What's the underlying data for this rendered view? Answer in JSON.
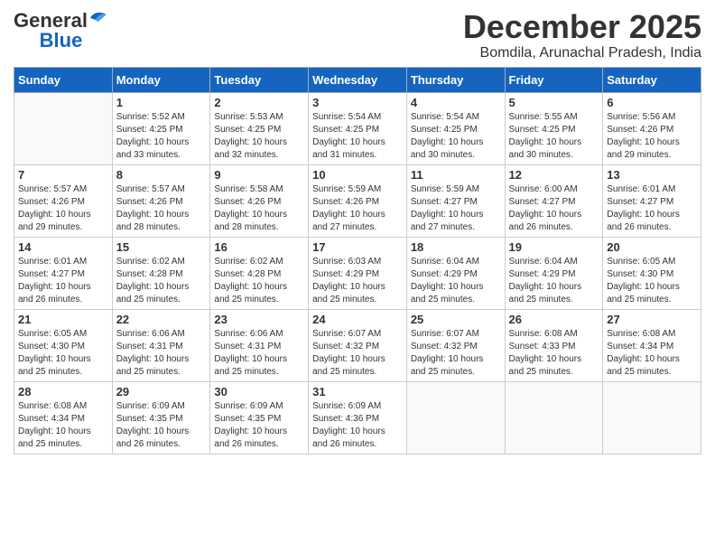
{
  "header": {
    "logo_general": "General",
    "logo_blue": "Blue",
    "month_title": "December 2025",
    "subtitle": "Bomdila, Arunachal Pradesh, India"
  },
  "days_of_week": [
    "Sunday",
    "Monday",
    "Tuesday",
    "Wednesday",
    "Thursday",
    "Friday",
    "Saturday"
  ],
  "weeks": [
    [
      {
        "day": "",
        "info": ""
      },
      {
        "day": "1",
        "info": "Sunrise: 5:52 AM\nSunset: 4:25 PM\nDaylight: 10 hours\nand 33 minutes."
      },
      {
        "day": "2",
        "info": "Sunrise: 5:53 AM\nSunset: 4:25 PM\nDaylight: 10 hours\nand 32 minutes."
      },
      {
        "day": "3",
        "info": "Sunrise: 5:54 AM\nSunset: 4:25 PM\nDaylight: 10 hours\nand 31 minutes."
      },
      {
        "day": "4",
        "info": "Sunrise: 5:54 AM\nSunset: 4:25 PM\nDaylight: 10 hours\nand 30 minutes."
      },
      {
        "day": "5",
        "info": "Sunrise: 5:55 AM\nSunset: 4:25 PM\nDaylight: 10 hours\nand 30 minutes."
      },
      {
        "day": "6",
        "info": "Sunrise: 5:56 AM\nSunset: 4:26 PM\nDaylight: 10 hours\nand 29 minutes."
      }
    ],
    [
      {
        "day": "7",
        "info": "Sunrise: 5:57 AM\nSunset: 4:26 PM\nDaylight: 10 hours\nand 29 minutes."
      },
      {
        "day": "8",
        "info": "Sunrise: 5:57 AM\nSunset: 4:26 PM\nDaylight: 10 hours\nand 28 minutes."
      },
      {
        "day": "9",
        "info": "Sunrise: 5:58 AM\nSunset: 4:26 PM\nDaylight: 10 hours\nand 28 minutes."
      },
      {
        "day": "10",
        "info": "Sunrise: 5:59 AM\nSunset: 4:26 PM\nDaylight: 10 hours\nand 27 minutes."
      },
      {
        "day": "11",
        "info": "Sunrise: 5:59 AM\nSunset: 4:27 PM\nDaylight: 10 hours\nand 27 minutes."
      },
      {
        "day": "12",
        "info": "Sunrise: 6:00 AM\nSunset: 4:27 PM\nDaylight: 10 hours\nand 26 minutes."
      },
      {
        "day": "13",
        "info": "Sunrise: 6:01 AM\nSunset: 4:27 PM\nDaylight: 10 hours\nand 26 minutes."
      }
    ],
    [
      {
        "day": "14",
        "info": "Sunrise: 6:01 AM\nSunset: 4:27 PM\nDaylight: 10 hours\nand 26 minutes."
      },
      {
        "day": "15",
        "info": "Sunrise: 6:02 AM\nSunset: 4:28 PM\nDaylight: 10 hours\nand 25 minutes."
      },
      {
        "day": "16",
        "info": "Sunrise: 6:02 AM\nSunset: 4:28 PM\nDaylight: 10 hours\nand 25 minutes."
      },
      {
        "day": "17",
        "info": "Sunrise: 6:03 AM\nSunset: 4:29 PM\nDaylight: 10 hours\nand 25 minutes."
      },
      {
        "day": "18",
        "info": "Sunrise: 6:04 AM\nSunset: 4:29 PM\nDaylight: 10 hours\nand 25 minutes."
      },
      {
        "day": "19",
        "info": "Sunrise: 6:04 AM\nSunset: 4:29 PM\nDaylight: 10 hours\nand 25 minutes."
      },
      {
        "day": "20",
        "info": "Sunrise: 6:05 AM\nSunset: 4:30 PM\nDaylight: 10 hours\nand 25 minutes."
      }
    ],
    [
      {
        "day": "21",
        "info": "Sunrise: 6:05 AM\nSunset: 4:30 PM\nDaylight: 10 hours\nand 25 minutes."
      },
      {
        "day": "22",
        "info": "Sunrise: 6:06 AM\nSunset: 4:31 PM\nDaylight: 10 hours\nand 25 minutes."
      },
      {
        "day": "23",
        "info": "Sunrise: 6:06 AM\nSunset: 4:31 PM\nDaylight: 10 hours\nand 25 minutes."
      },
      {
        "day": "24",
        "info": "Sunrise: 6:07 AM\nSunset: 4:32 PM\nDaylight: 10 hours\nand 25 minutes."
      },
      {
        "day": "25",
        "info": "Sunrise: 6:07 AM\nSunset: 4:32 PM\nDaylight: 10 hours\nand 25 minutes."
      },
      {
        "day": "26",
        "info": "Sunrise: 6:08 AM\nSunset: 4:33 PM\nDaylight: 10 hours\nand 25 minutes."
      },
      {
        "day": "27",
        "info": "Sunrise: 6:08 AM\nSunset: 4:34 PM\nDaylight: 10 hours\nand 25 minutes."
      }
    ],
    [
      {
        "day": "28",
        "info": "Sunrise: 6:08 AM\nSunset: 4:34 PM\nDaylight: 10 hours\nand 25 minutes."
      },
      {
        "day": "29",
        "info": "Sunrise: 6:09 AM\nSunset: 4:35 PM\nDaylight: 10 hours\nand 26 minutes."
      },
      {
        "day": "30",
        "info": "Sunrise: 6:09 AM\nSunset: 4:35 PM\nDaylight: 10 hours\nand 26 minutes."
      },
      {
        "day": "31",
        "info": "Sunrise: 6:09 AM\nSunset: 4:36 PM\nDaylight: 10 hours\nand 26 minutes."
      },
      {
        "day": "",
        "info": ""
      },
      {
        "day": "",
        "info": ""
      },
      {
        "day": "",
        "info": ""
      }
    ]
  ]
}
